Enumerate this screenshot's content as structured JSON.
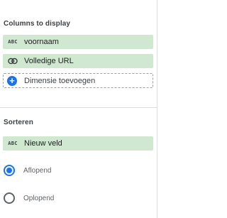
{
  "columns_section": {
    "title": "Columns to display",
    "chips": [
      {
        "icon": "abc-text-type-icon",
        "icon_text": "ABC",
        "label": "voornaam"
      },
      {
        "icon": "link-icon",
        "label": "Volledige URL"
      }
    ],
    "add_dimension": {
      "icon": "plus-icon",
      "label": "Dimensie toevoegen"
    }
  },
  "sort_section": {
    "title": "Sorteren",
    "field": {
      "icon": "abc-text-type-icon",
      "icon_text": "ABC",
      "label": "Nieuw veld"
    },
    "options": [
      {
        "label": "Aflopend",
        "checked": true
      },
      {
        "label": "Oplopend",
        "checked": false
      }
    ]
  },
  "colors": {
    "chip_bg": "#cfe8cf",
    "accent": "#1a73e8",
    "divider": "#dadce0"
  }
}
